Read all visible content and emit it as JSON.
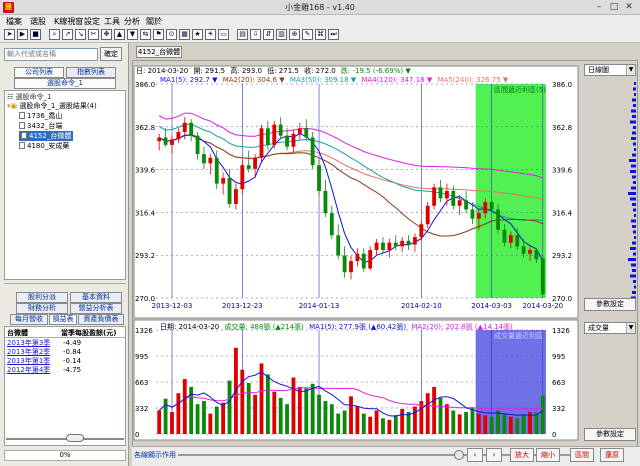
{
  "window": {
    "title": "小金雞168 - v1.40",
    "logo": "雞"
  },
  "menu": [
    "檔案",
    "選股",
    "K線視窗",
    "設定",
    "工具",
    "分析",
    "關於"
  ],
  "toolbar_icons": [
    "fwd-icon",
    "play-icon",
    "stop-icon",
    "search-icon",
    "chart-up-icon",
    "chart-down-icon",
    "cut-icon",
    "move-icon",
    "arrow-up-icon",
    "arrow-down-icon",
    "split-icon",
    "flag-icon",
    "pin-icon",
    "grid-icon",
    "star-icon",
    "sun-icon",
    "screen-icon",
    "table-icon",
    "down-icon",
    "split2-icon",
    "chart-icon",
    "zoom-icon",
    "edit-icon",
    "cmd-icon",
    "end-icon"
  ],
  "left": {
    "search_placeholder": "輸入代號或名稱",
    "confirm": "確定",
    "tabs_top": [
      "公司列表",
      "指數列表"
    ],
    "tab_group": "選股命令_1",
    "tree_header": "選股命令_1",
    "tree_root": "選股命令_1_選股結果(4)",
    "tree_items": [
      "1736_喬山",
      "3432_台端",
      "4152_台微體",
      "4180_安成藥"
    ],
    "tree_selected_index": 2,
    "tabs_bottom_row1": [
      "股利分派",
      "基本資料"
    ],
    "tabs_bottom_row2": [
      "財務分析",
      "營益分析表"
    ],
    "tabs_bottom_row3": [
      "每月營收",
      "損益表",
      "資產負債表"
    ],
    "fin_header_name": "台微體",
    "fin_header_col": "當季每股盈餘(元)",
    "fin_rows": [
      {
        "period": "2013年第3季",
        "value": "-4.49"
      },
      {
        "period": "2013年第2季",
        "value": "-0.84"
      },
      {
        "period": "2013年第1季",
        "value": "-0.14"
      },
      {
        "period": "2012年第4季",
        "value": "-4.75"
      }
    ],
    "pct": "0%"
  },
  "chart_tab": "4152_台微體",
  "kline": {
    "info_line1": {
      "date": "日: 2014-03-20",
      "open": "開: 291.5",
      "high": "高: 293.0",
      "low": "低: 271.5",
      "close": "收: 272.0",
      "chg": "跌: -19.5 (-6.69%)"
    },
    "ma": [
      {
        "label": "MA1(5): 292.7",
        "color": "#1010e0"
      },
      {
        "label": "MA2(20): 304.6",
        "color": "#8a3b12"
      },
      {
        "label": "MA3(50): 309.18",
        "color": "#18a0a0"
      },
      {
        "label": "MA4(120): 347.18",
        "color": "#e020e0"
      },
      {
        "label": "MA5(240): 326.75",
        "color": "#f07060"
      }
    ],
    "yticks": [
      "386.0",
      "362.8",
      "339.6",
      "316.4",
      "293.2",
      "270.0"
    ],
    "xticks": [
      "2013-12-03",
      "2013-12-23",
      "2014-01-13",
      "2014-02-10",
      "2014-03-03",
      "2014-03-20"
    ],
    "annotation": "區間遞近利區(5)",
    "combo": "日線圖",
    "param_btn": "參數設定"
  },
  "volume": {
    "info": {
      "date": "日期: 2014-03-20",
      "vol": "成交量: 488張",
      "vol_chg": "(▲214張)",
      "ma1": "MA1(5): 277.9張",
      "ma1_chg": "(▲60.42張)",
      "ma2": "MA2(20): 202.8張",
      "ma2_chg": "(▲14.14張)"
    },
    "yticks": [
      "1326",
      "995",
      "663",
      "332",
      "0"
    ],
    "annotation": "成交量遞近利區",
    "combo": "成交量",
    "param_btn": "參數設定"
  },
  "bottom": {
    "label": "各線顯示作用",
    "buttons": [
      "放大",
      "縮小",
      "區間",
      "還原"
    ]
  },
  "colors": {
    "up": "#e00000",
    "down": "#0a8a0a",
    "ma1": "#1010e0",
    "ma2": "#8a3b12",
    "ma3": "#18a0a0",
    "ma4": "#e020e0",
    "ma5": "#f07060",
    "highlight": "#33ee33",
    "vol_highlight": "#3333dd"
  },
  "chart_data": {
    "type": "candlestick",
    "x_range": [
      "2013-11-25",
      "2014-03-20"
    ],
    "ylim": [
      270.0,
      386.0
    ],
    "candles": [
      [
        355,
        359,
        350,
        357
      ],
      [
        357,
        362,
        352,
        353
      ],
      [
        353,
        358,
        348,
        356
      ],
      [
        356,
        362,
        354,
        360
      ],
      [
        360,
        368,
        356,
        365
      ],
      [
        365,
        367,
        355,
        358
      ],
      [
        358,
        360,
        345,
        348
      ],
      [
        348,
        352,
        340,
        343
      ],
      [
        343,
        348,
        337,
        346
      ],
      [
        346,
        350,
        329,
        332
      ],
      [
        332,
        338,
        326,
        335
      ],
      [
        335,
        340,
        319,
        321
      ],
      [
        321,
        332,
        318,
        329
      ],
      [
        329,
        345,
        326,
        342
      ],
      [
        342,
        350,
        338,
        340
      ],
      [
        340,
        348,
        335,
        346
      ],
      [
        346,
        364,
        344,
        362
      ],
      [
        362,
        366,
        350,
        353
      ],
      [
        353,
        366,
        351,
        364
      ],
      [
        364,
        368,
        356,
        358
      ],
      [
        358,
        362,
        350,
        352
      ],
      [
        352,
        361,
        349,
        359
      ],
      [
        359,
        365,
        356,
        362
      ],
      [
        362,
        367,
        355,
        357
      ],
      [
        357,
        360,
        340,
        342
      ],
      [
        342,
        345,
        325,
        328
      ],
      [
        328,
        334,
        314,
        316
      ],
      [
        316,
        320,
        302,
        304
      ],
      [
        304,
        310,
        291,
        293
      ],
      [
        293,
        298,
        281,
        284
      ],
      [
        284,
        293,
        280,
        290
      ],
      [
        290,
        297,
        287,
        294
      ],
      [
        294,
        297,
        284,
        286
      ],
      [
        286,
        298,
        285,
        296
      ],
      [
        296,
        302,
        293,
        300
      ],
      [
        300,
        303,
        294,
        296
      ],
      [
        296,
        302,
        292,
        300
      ],
      [
        300,
        304,
        296,
        298
      ],
      [
        298,
        303,
        295,
        301
      ],
      [
        301,
        304,
        296,
        299
      ],
      [
        299,
        305,
        295,
        303
      ],
      [
        303,
        312,
        301,
        310
      ],
      [
        310,
        322,
        308,
        320
      ],
      [
        320,
        332,
        318,
        330
      ],
      [
        330,
        334,
        322,
        324
      ],
      [
        324,
        332,
        320,
        328
      ],
      [
        328,
        331,
        318,
        320
      ],
      [
        320,
        326,
        315,
        323
      ],
      [
        323,
        328,
        316,
        318
      ],
      [
        318,
        322,
        310,
        313
      ],
      [
        313,
        318,
        307,
        316
      ],
      [
        316,
        324,
        313,
        322
      ],
      [
        322,
        325,
        316,
        318
      ],
      [
        318,
        321,
        305,
        307
      ],
      [
        307,
        310,
        298,
        300
      ],
      [
        300,
        306,
        297,
        304
      ],
      [
        304,
        308,
        296,
        298
      ],
      [
        298,
        302,
        292,
        294
      ],
      [
        294,
        298,
        290,
        296
      ],
      [
        296,
        297,
        289,
        291
      ],
      [
        291.5,
        293,
        271.5,
        272
      ]
    ],
    "volume": [
      300,
      450,
      280,
      520,
      700,
      600,
      380,
      420,
      260,
      350,
      400,
      680,
      1100,
      820,
      650,
      500,
      900,
      760,
      540,
      460,
      380,
      720,
      600,
      580,
      640,
      500,
      420,
      380,
      260,
      300,
      480,
      350,
      260,
      220,
      300,
      200,
      180,
      240,
      320,
      280,
      350,
      420,
      520,
      600,
      460,
      380,
      300,
      250,
      280,
      330,
      260,
      240,
      220,
      300,
      260,
      220,
      200,
      240,
      280,
      274,
      488
    ],
    "volume_ylim": [
      0,
      1326
    ],
    "ma": [
      {
        "name": "MA1(5)",
        "last": 292.7
      },
      {
        "name": "MA2(20)",
        "last": 304.6
      },
      {
        "name": "MA3(50)",
        "last": 309.18
      },
      {
        "name": "MA4(120)",
        "last": 347.18
      },
      {
        "name": "MA5(240)",
        "last": 326.75
      }
    ]
  }
}
